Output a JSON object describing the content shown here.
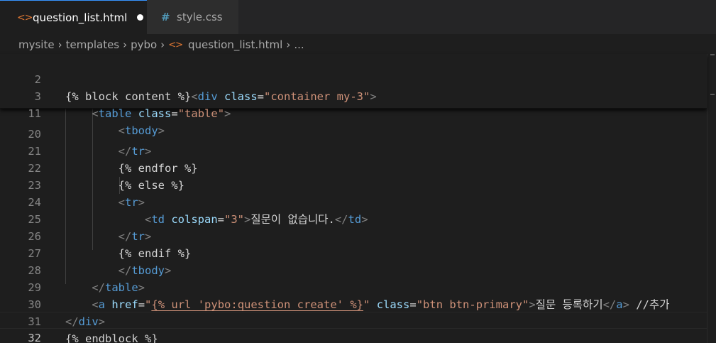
{
  "tabs": [
    {
      "label": "question_list.html",
      "icon": "html-file-icon",
      "active": true,
      "modified": true
    },
    {
      "label": "style.css",
      "icon": "css-file-icon",
      "active": false
    }
  ],
  "breadcrumb": [
    "mysite",
    "templates",
    "pybo",
    "question_list.html",
    "..."
  ],
  "icons": {
    "html": "<>",
    "css": "#",
    "separator": "›"
  },
  "colors": {
    "tag": "#569cd6",
    "attribute": "#9cdcfe",
    "string": "#ce9178",
    "text": "#d4d4d4",
    "line_number": "#858585",
    "html_icon": "#e37933",
    "css_icon": "#519aba"
  },
  "sticky_lines": [
    {
      "num": "2",
      "tokens": [
        "{% block content %}",
        "<",
        "div",
        " ",
        "class",
        "=",
        "\"container my-3\"",
        ">"
      ]
    },
    {
      "num": "3",
      "tokens": [
        "    ",
        "<",
        "table",
        " ",
        "class",
        "=",
        "\"table\"",
        ">"
      ]
    },
    {
      "num": "11",
      "tokens": [
        "        ",
        "<",
        "tbody",
        ">"
      ]
    }
  ],
  "lines": [
    {
      "num": "20",
      "tokens": [
        "        ",
        "</",
        "tr",
        ">"
      ]
    },
    {
      "num": "21",
      "tokens": [
        "        ",
        "{% endfor %}"
      ]
    },
    {
      "num": "22",
      "tokens": [
        "        ",
        "{% else %}"
      ]
    },
    {
      "num": "23",
      "tokens": [
        "        ",
        "<",
        "tr",
        ">"
      ]
    },
    {
      "num": "24",
      "tokens": [
        "            ",
        "<",
        "td",
        " ",
        "colspan",
        "=",
        "\"3\"",
        ">",
        "질문이 없습니다.",
        "</",
        "td",
        ">"
      ]
    },
    {
      "num": "25",
      "tokens": [
        "        ",
        "</",
        "tr",
        ">"
      ]
    },
    {
      "num": "26",
      "tokens": [
        "        ",
        "{% endif %}"
      ]
    },
    {
      "num": "27",
      "tokens": [
        "        ",
        "</",
        "tbody",
        ">"
      ]
    },
    {
      "num": "28",
      "tokens": [
        "    ",
        "</",
        "table",
        ">"
      ]
    },
    {
      "num": "29",
      "tokens": [
        "    ",
        "<",
        "a",
        " ",
        "href",
        "=",
        "\"",
        "{% url 'pybo:question_create' %}",
        "\"",
        " ",
        "class",
        "=",
        "\"btn btn-primary\"",
        ">",
        "질문 등록하기",
        "</",
        "a",
        ">",
        " //추가"
      ]
    },
    {
      "num": "30",
      "tokens": [
        "",
        "</",
        "div",
        ">"
      ]
    },
    {
      "num": "31",
      "tokens": [
        "",
        "{% endblock %}"
      ]
    },
    {
      "num": "32",
      "tokens": [
        ""
      ]
    }
  ]
}
